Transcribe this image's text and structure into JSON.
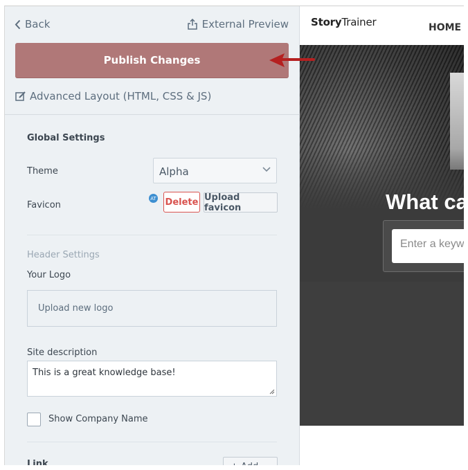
{
  "sidebar": {
    "back_label": "Back",
    "external_preview_label": "External Preview",
    "publish_label": "Publish Changes",
    "advanced_label": "Advanced Layout (HTML, CSS & JS)",
    "global_settings_title": "Global Settings",
    "theme_label": "Theme",
    "theme_value": "Alpha",
    "favicon_label": "Favicon",
    "favicon_badge": "AT",
    "delete_label": "Delete",
    "upload_favicon_label": "Upload favicon",
    "header_settings_title": "Header Settings",
    "your_logo_label": "Your Logo",
    "upload_logo_label": "Upload new logo",
    "site_description_label": "Site description",
    "site_description_value": "This is a great knowledge base!",
    "show_company_name_label": "Show Company Name",
    "cut_off_label": "Link",
    "cut_off_button": "+ Add link"
  },
  "preview": {
    "brand_bold": "Story",
    "brand_light": "Trainer",
    "nav_home": "HOME",
    "hero_title": "What ca",
    "search_placeholder": "Enter a keyw"
  },
  "colors": {
    "publish_button": "#b07878",
    "delete_button": "#d9534f",
    "arrow": "#b52020",
    "sidebar_bg": "#edf1f4"
  }
}
